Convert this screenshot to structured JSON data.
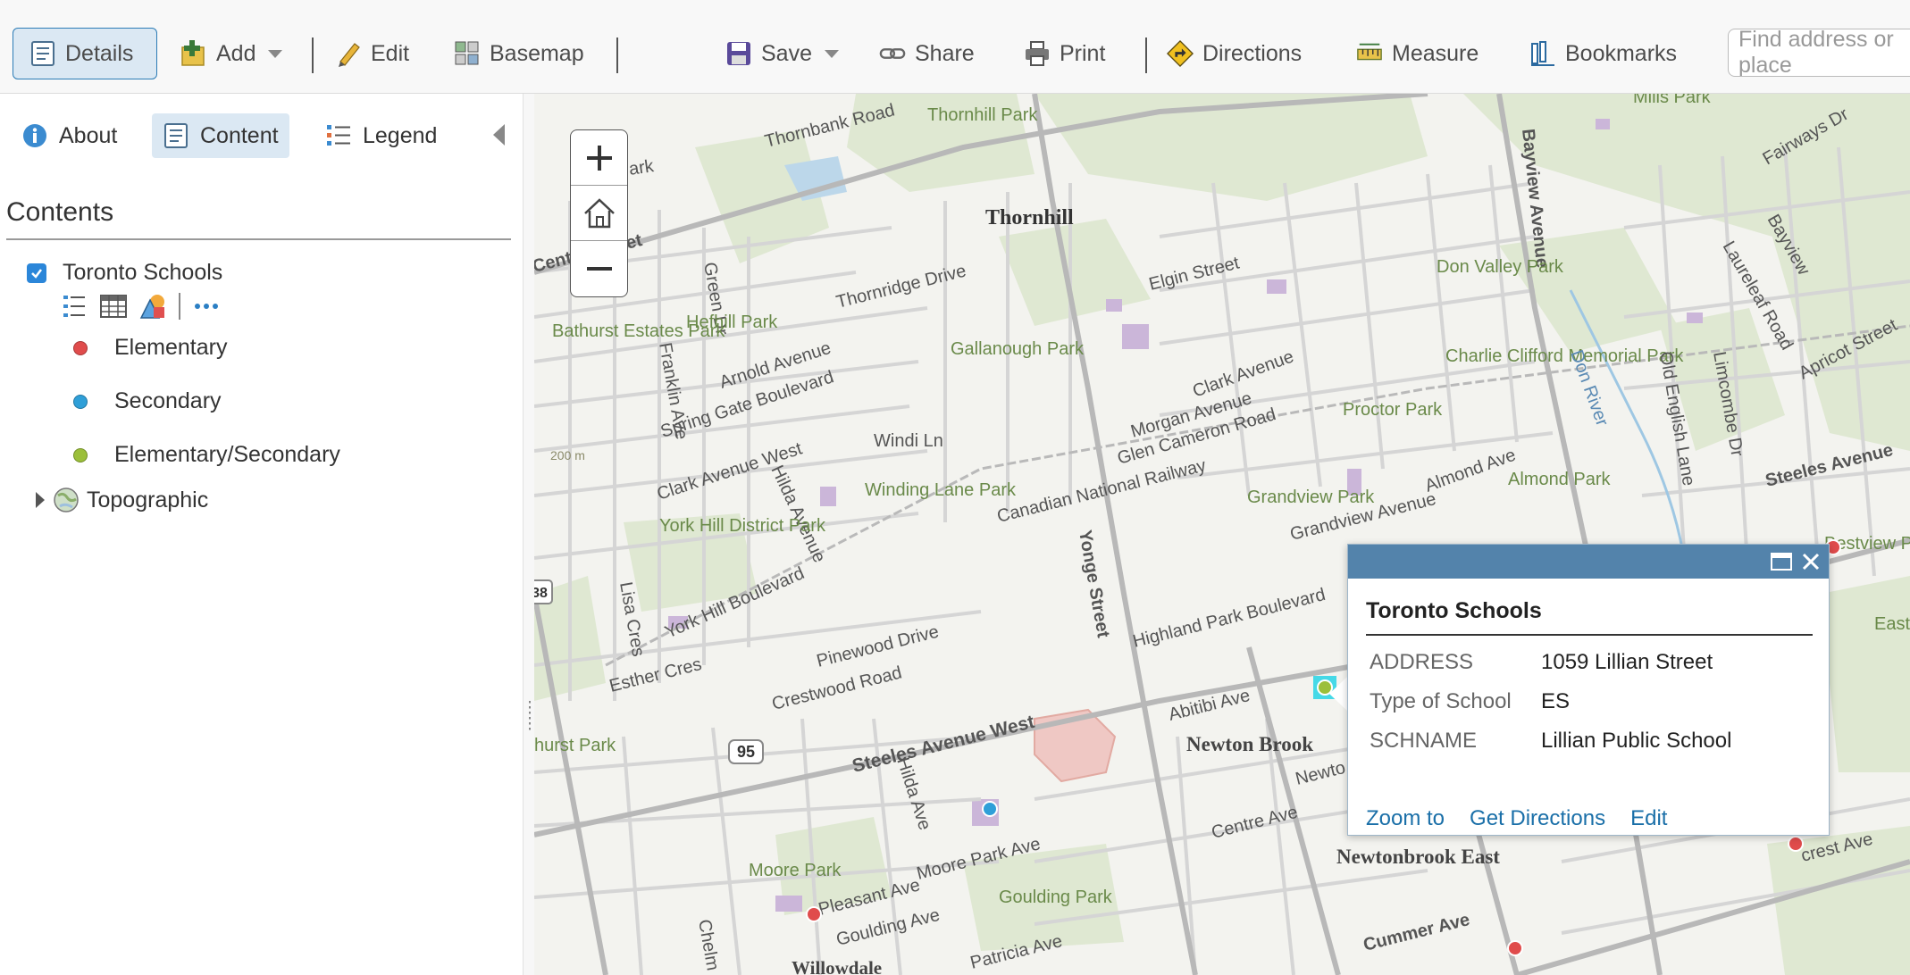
{
  "toolbar": {
    "details": "Details",
    "add": "Add",
    "edit": "Edit",
    "basemap": "Basemap",
    "save": "Save",
    "share": "Share",
    "print": "Print",
    "directions": "Directions",
    "measure": "Measure",
    "bookmarks": "Bookmarks",
    "search_placeholder": "Find address or place"
  },
  "panel": {
    "tabs": {
      "about": "About",
      "content": "Content",
      "legend": "Legend"
    },
    "contents_title": "Contents",
    "layer": {
      "name": "Toronto Schools",
      "checked": true,
      "legend": [
        {
          "label": "Elementary",
          "color": "#e04c4c"
        },
        {
          "label": "Secondary",
          "color": "#2f9fd8"
        },
        {
          "label": "Elementary/Secondary",
          "color": "#9bbf3a"
        }
      ]
    },
    "basemap_layer": "Topographic"
  },
  "map": {
    "labels": {
      "thornbank_road": "Thornbank Road",
      "thornhill_park": "Thornhill Park",
      "thornhill": "Thornhill",
      "rose_park": "Rose Park",
      "green_dr": "Green Dr",
      "centre_street": "Centre Street",
      "thornridge_drive": "Thornridge Drive",
      "elgin_street": "Elgin Street",
      "bathurst_estates_park": "Bathurst Estates Park",
      "hefhill_park": "Hefhill Park",
      "franklin_ave": "Franklin Ave",
      "arnold_avenue": "Arnold Avenue",
      "gallanough_park": "Gallanough Park",
      "spring_gate_boulevard": "Spring Gate Boulevard",
      "clark_avenue": "Clark Avenue",
      "morgan_avenue": "Morgan Avenue",
      "glen_cameron_road": "Glen Cameron Road",
      "proctor_park": "Proctor Park",
      "clark_avenue_west": "Clark Avenue West",
      "windi_ln": "Windi Ln",
      "winding_lane_park": "Winding Lane Park",
      "hilda_avenue": "Hilda Avenue",
      "canadian_national_railway": "Canadian National Railway",
      "grandview_park": "Grandview Park",
      "grandview_avenue": "Grandview Avenue",
      "almond_ave": "Almond Ave",
      "almond_park": "Almond Park",
      "york_hill_district_park": "York Hill District Park",
      "yonge_street": "Yonge Street",
      "york_hill_boulevard": "York Hill Boulevard",
      "highland_park_boulevard": "Highland Park Boulevard",
      "esther_cres": "Esther Cres",
      "lisa_cres": "Lisa Cres",
      "pinewood_drive": "Pinewood Drive",
      "crestwood_road": "Crestwood Road",
      "abitibi_ave": "Abitibi Ave",
      "newton_brook": "Newton Brook",
      "steeles_avenue_west": "Steeles Avenue West",
      "route_95": "95",
      "route_38": "38",
      "hilda_ave": "Hilda Ave",
      "centre_ave": "Centre Ave",
      "newtonbrook_east": "Newtonbrook East",
      "moore_park": "Moore Park",
      "moore_park_ave": "Moore Park Ave",
      "goulding_park": "Goulding Park",
      "pleasant_ave": "Pleasant Ave",
      "goulding_ave": "Goulding Ave",
      "cummer_ave": "Cummer Ave",
      "patricia_ave": "Patricia Ave",
      "willowdale": "Willowdale",
      "bayview_avenue": "Bayview Avenue",
      "don_valley_park": "Don Valley Park",
      "charlie_clifford_memorial_park": "Charlie Clifford Memorial Park",
      "don_river": "Don River",
      "old_english_lane": "Old English Lane",
      "limcombe_dr": "Limcombe Dr",
      "laureleaf_road": "Laureleaf Road",
      "apricot_street": "Apricot Street",
      "fairways_dr": "Fairways Dr",
      "bayview_short": "Bayview",
      "steeles_avenue": "Steeles Avenue",
      "bestview_park": "Bestview Park",
      "elevation_200m": "200 m",
      "hurst_park": "hurst Park",
      "newton_partial": "Newto",
      "crest_ave": "crest Ave",
      "chelm": "Chelm",
      "mills_park": "Mills Park",
      "east_don_parkland": "East Don Parkland"
    }
  },
  "popup": {
    "title": "Toronto Schools",
    "attributes": [
      {
        "key": "ADDRESS",
        "value": "1059 Lillian Street"
      },
      {
        "key": "Type of School",
        "value": "ES"
      },
      {
        "key": "SCHNAME",
        "value": "Lillian Public School"
      }
    ],
    "links": {
      "zoom_to": "Zoom to",
      "get_directions": "Get Directions",
      "edit": "Edit"
    }
  }
}
